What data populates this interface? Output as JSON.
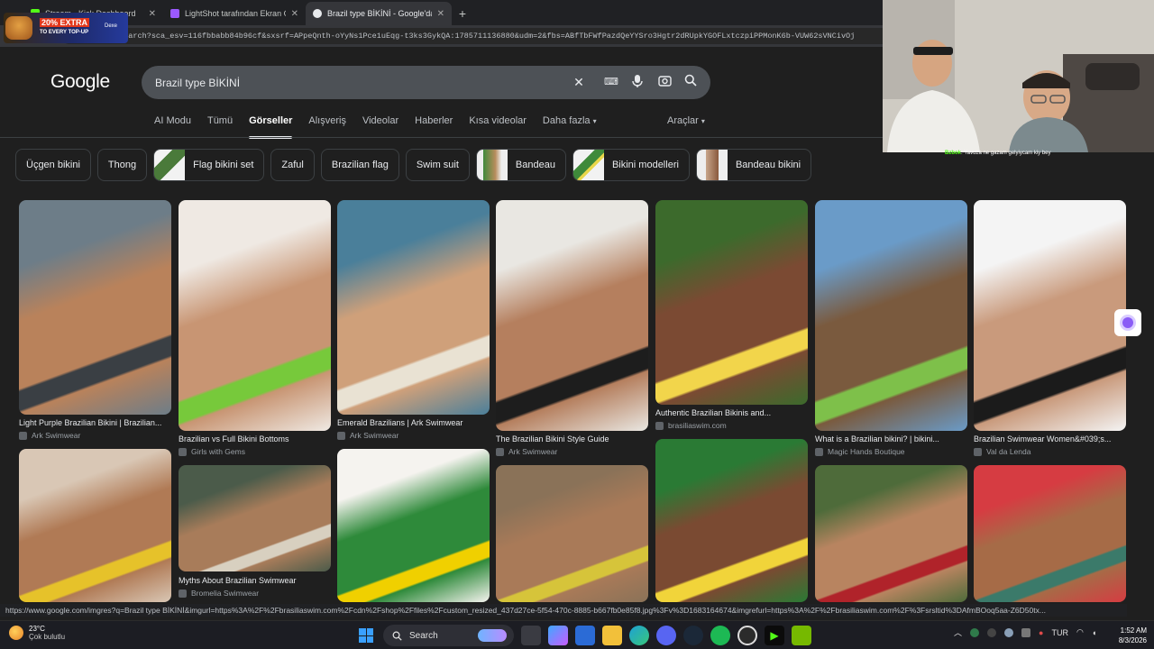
{
  "browser": {
    "tabs": [
      {
        "title": "Stream - Kick Dashboard",
        "favicon_color": "#53fc18"
      },
      {
        "title": "LightShot tarafından Ekran Görünt",
        "favicon_color": "#9b59ff"
      },
      {
        "title": "Brazil type BİKİNİ - Google'da Ara",
        "favicon_color": "#e8eaed",
        "active": true
      }
    ],
    "url": "google.com/search?sca_esv=116fbbabb84b96cf&sxsrf=APpeQnth-oYyNs1Pce1uEqg-t3ks3GykQA:1785711136880&udm=2&fbs=ABfTbFWfPazdQeYYSro3Hgtr2dRUpkYGOFLxtczpiPPMonK6b-VUW62sVNCivOj"
  },
  "promo": {
    "line1": "20% EXTRA",
    "line2": "TO EVERY TOP-UP",
    "brand": "Dexe"
  },
  "google": {
    "logo": "Google",
    "query": "Brazil type BİKİNİ",
    "tabs": [
      "AI Modu",
      "Tümü",
      "Görseller",
      "Alışveriş",
      "Videolar",
      "Haberler",
      "Kısa videolar",
      "Daha fazla"
    ],
    "active_tab": "Görseller",
    "tools": "Araçlar",
    "chips": [
      {
        "label": "Üçgen bikini"
      },
      {
        "label": "Thong"
      },
      {
        "label": "Flag bikini set",
        "thumb": "#4a7a3a"
      },
      {
        "label": "Zaful"
      },
      {
        "label": "Brazilian flag"
      },
      {
        "label": "Swim suit"
      },
      {
        "label": "Bandeau",
        "thumb": "#3f8a3a"
      },
      {
        "label": "Bikini modelleri",
        "thumb": "#d8d2c6"
      },
      {
        "label": "Bandeau bikini",
        "thumb": "#c7a58a"
      }
    ]
  },
  "results": [
    {
      "caption": "Light Purple Brazilian Bikini | Brazilian...",
      "source": "Ark Swimwear",
      "colors": [
        "#6d7d88",
        "#b9825b",
        "#3a3f44"
      ]
    },
    {
      "caption": "Brazilian vs Full Bikini Bottoms",
      "source": "Girls with Gems",
      "colors": [
        "#efe9e3",
        "#c89573",
        "#77c93b"
      ]
    },
    {
      "caption": "Emerald Brazilians | Ark Swimwear",
      "source": "Ark Swimwear",
      "colors": [
        "#4a7f9a",
        "#cfa07a",
        "#e9e2d3"
      ]
    },
    {
      "caption": "The Brazilian Bikini Style Guide",
      "source": "Ark Swimwear",
      "colors": [
        "#e9e7e2",
        "#b57f5e",
        "#1d1d1d"
      ]
    },
    {
      "caption": "Authentic Brazilian Bikinis and...",
      "source": "brasiliaswim.com",
      "colors": [
        "#3c6a2c",
        "#7b4a33",
        "#f2d54b"
      ]
    },
    {
      "caption": "What is a Brazilian bikini? | bikini...",
      "source": "Magic Hands Boutique",
      "colors": [
        "#6a9bc8",
        "#7a5a3e",
        "#7ec04a"
      ]
    },
    {
      "caption": "Brazilian Swimwear Women&#039;s...",
      "source": "Val da Lenda",
      "colors": [
        "#f4f4f4",
        "#c99a7c",
        "#1b1b1b"
      ]
    },
    {
      "caption": "",
      "source": "",
      "colors": [
        "#d9c7b5",
        "#b07a55",
        "#e6c22a"
      ]
    },
    {
      "caption": "Myths About Brazilian Swimwear",
      "source": "Bromelia Swimwear",
      "colors": [
        "#4b5b4a",
        "#a87c5a",
        "#d8d0c0"
      ]
    },
    {
      "caption": "",
      "source": "",
      "colors": [
        "#f5f3ef",
        "#2e8a3a",
        "#f0d000"
      ]
    },
    {
      "caption": "",
      "source": "",
      "colors": [
        "#8a7258",
        "#a97a58",
        "#d6c43a"
      ]
    },
    {
      "caption": "",
      "source": "",
      "colors": [
        "#2a7a34",
        "#7a4a32",
        "#f1d43a"
      ]
    },
    {
      "caption": "",
      "source": "",
      "colors": [
        "#4e6b3a",
        "#b88460",
        "#b0232a"
      ]
    },
    {
      "caption": "",
      "source": "",
      "colors": [
        "#d63c42",
        "#a66b47",
        "#3b7a6a"
      ]
    }
  ],
  "status_url": "https://www.google.com/imgres?q=Brazil type BİKİNİ&imgurl=https%3A%2F%2Fbrasiliaswim.com%2Fcdn%2Fshop%2Ffiles%2Fcustom_resized_437d27ce-5f54-470c-8885-b667fb0e85f8.jpg%3Fv%3D1683164674&imgrefurl=https%3A%2F%2Fbrasiliaswim.com%2F%3Fsrsltid%3DAfmBOoq5aa-Z6D50tx...",
  "chat": {
    "user": "Bzbok",
    "message": ": Yavuza ne gazam gelyiycam kiy bey"
  },
  "taskbar": {
    "temperature": "23°C",
    "weather": "Çok bulutlu",
    "search": "Search",
    "language": "TUR",
    "time": "1:52 AM",
    "date": "8/3/2026"
  }
}
